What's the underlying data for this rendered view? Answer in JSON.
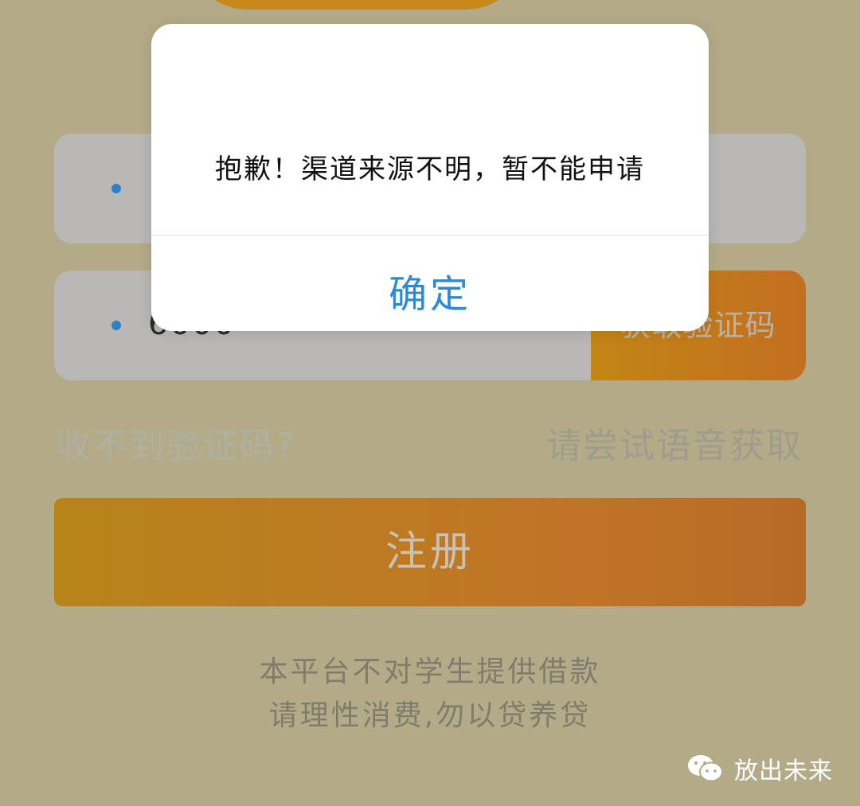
{
  "form": {
    "phone_value": "",
    "code_value": "6000",
    "get_code_label": "获取验证码",
    "no_code_hint": "收不到验证码?",
    "voice_hint": "请尝试语音获取",
    "register_label": "注册"
  },
  "notice": {
    "line1": "本平台不对学生提供借款",
    "line2": "请理性消费,勿以贷养贷"
  },
  "dialog": {
    "message": "抱歉！渠道来源不明，暂不能申请",
    "confirm_label": "确定"
  },
  "watermark": {
    "icon": "wechat-icon",
    "text": "放出未来"
  },
  "colors": {
    "backdrop": "#b3ab88",
    "accent_orange": "#c17427",
    "link_blue": "#2b8ad6"
  }
}
